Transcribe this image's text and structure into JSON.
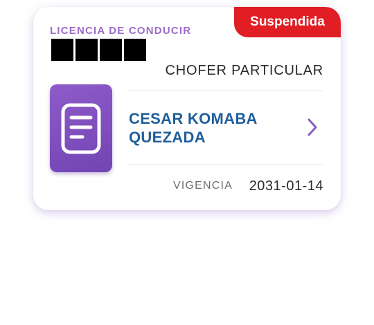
{
  "license_card": {
    "type_label": "LICENCIA DE CONDUCIR",
    "status_badge": "Suspendida",
    "category": "CHOFER PARTICULAR",
    "holder_name_line1": "CESAR KOMABA",
    "holder_name_line2": "QUEZADA",
    "validity_label": "VIGENCIA",
    "validity_date": "2031-01-14",
    "document_icon": "document-icon",
    "chevron_icon": "chevron-right-icon",
    "colors": {
      "status_badge": "#e01e24",
      "type_label": "#9c6cc8",
      "icon_tile": "#7e4fbf",
      "holder_name": "#1f5f9a",
      "chevron": "#8a5cc4"
    }
  }
}
